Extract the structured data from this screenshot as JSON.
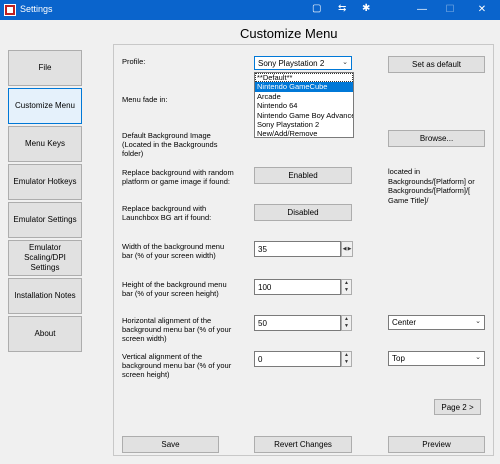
{
  "window": {
    "title": "Settings",
    "minimize": "—",
    "maximize": "☐",
    "close": "✕"
  },
  "page_title": "Customize Menu",
  "nav": [
    {
      "label": "File"
    },
    {
      "label": "Customize Menu"
    },
    {
      "label": "Menu Keys"
    },
    {
      "label": "Emulator Hotkeys"
    },
    {
      "label": "Emulator Settings"
    },
    {
      "label": "Emulator Scaling/DPI Settings"
    },
    {
      "label": "Installation Notes"
    },
    {
      "label": "About"
    }
  ],
  "profile": {
    "label": "Profile:",
    "selected": "Sony Playstation 2",
    "set_default_label": "Set as default",
    "options": [
      "**Default**",
      "Nintendo GameCube",
      "Arcade",
      "Nintendo 64",
      "Nintendo Game Boy Advance",
      "Sony Playstation 2",
      "New/Add/Remove"
    ]
  },
  "fade": {
    "label": "Menu fade in:"
  },
  "background": {
    "label": "Default Background Image (Located in the Backgrounds folder)",
    "browse_label": "Browse..."
  },
  "replace_platform": {
    "label": "Replace background with random platform or game image if found:",
    "button": "Enabled"
  },
  "replace_launchbox": {
    "label": "Replace background with Launchbox BG art if found:",
    "button": "Disabled"
  },
  "note": "located in Backgrounds/[Platform] or Backgrounds/[Platform]/[ Game Title]/",
  "width": {
    "label": "Width of the background menu bar (% of your screen width)",
    "value": "35"
  },
  "height": {
    "label": "Height of the background menu bar (% of your screen height)",
    "value": "100"
  },
  "h_align": {
    "label": "Horizontal alignment of the background menu bar (% of your screen width)",
    "value": "50",
    "selected": "Center"
  },
  "v_align": {
    "label": "Vertical alignment of the background menu bar (% of your screen height)",
    "value": "0",
    "selected": "Top"
  },
  "page_button": "Page 2 >",
  "footer": {
    "save": "Save",
    "revert": "Revert Changes",
    "preview": "Preview"
  }
}
